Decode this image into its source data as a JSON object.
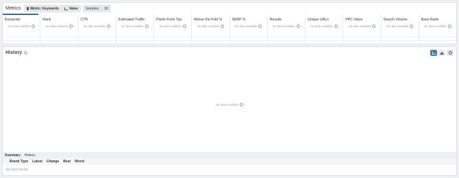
{
  "metrics": {
    "title": "Metrics",
    "toolbar": {
      "metric_label": "Metric: Keywords",
      "value_label": "Value",
      "samples_label": "Samples",
      "samples_value": "30"
    },
    "columns": [
      {
        "header": "Keywords",
        "value": "No data available"
      },
      {
        "header": "Rank",
        "value": "No data available"
      },
      {
        "header": "CTR",
        "value": "No data available"
      },
      {
        "header": "Estimated Traffic",
        "value": "No data available"
      },
      {
        "header": "Pixels From Top",
        "value": "No data available"
      },
      {
        "header": "Above the Fold %",
        "value": "No data available"
      },
      {
        "header": "SERP %",
        "value": "No data available"
      },
      {
        "header": "Results",
        "value": "No data available"
      },
      {
        "header": "Unique URLs",
        "value": "No data available"
      },
      {
        "header": "PPC Value",
        "value": "No data available"
      },
      {
        "header": "Search Volume",
        "value": "No data available"
      },
      {
        "header": "Base Rank",
        "value": "No data available"
      }
    ]
  },
  "history": {
    "title": "History",
    "empty_text": "No data available",
    "tabs": [
      "Summary",
      "History"
    ],
    "table_headers": [
      "Brand Type",
      "Latest",
      "Change",
      "Best",
      "Worst"
    ],
    "no_rows": "No rows found."
  },
  "colors": {
    "accent": "#2b6ea6",
    "active_button": "#4a7bb0",
    "muted_text": "#9aa0a6"
  },
  "icons": {
    "metric_chip": "pin-icon",
    "value_chip": "chart-icon",
    "info": "info-icon",
    "history_buttons": [
      "line-chart-icon",
      "area-chart-icon",
      "settings-icon"
    ]
  }
}
